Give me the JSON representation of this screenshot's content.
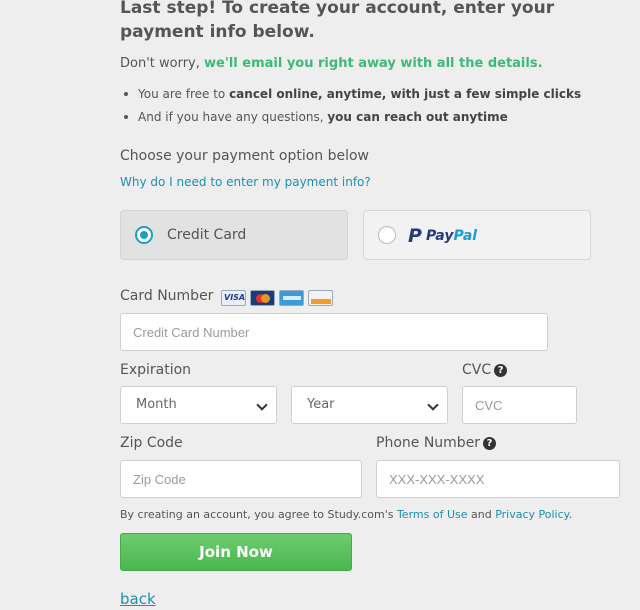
{
  "heading": "Last step! To create your account, enter your payment info below.",
  "reassure": {
    "prefix": "Don't worry, ",
    "highlight": "we'll email you right away with all the details."
  },
  "bullets": [
    {
      "prefix": "You are free to ",
      "bold": "cancel online, anytime, with just a few simple clicks"
    },
    {
      "prefix": "And if you have any questions, ",
      "bold": "you can reach out anytime"
    }
  ],
  "choose_label": "Choose your payment option below",
  "why_link": "Why do I need to enter my payment info?",
  "payment_options": {
    "credit_card": {
      "label": "Credit Card",
      "selected": true
    },
    "paypal": {
      "label_a": "Pay",
      "label_b": "Pal",
      "selected": false
    }
  },
  "card_number": {
    "label": "Card Number",
    "placeholder": "Credit Card Number",
    "card_icons": [
      "visa-icon",
      "mastercard-icon",
      "amex-icon",
      "discover-icon"
    ]
  },
  "expiration": {
    "label": "Expiration",
    "month_value": "Month",
    "year_value": "Year"
  },
  "cvc": {
    "label": "CVC",
    "placeholder": "CVC",
    "help_glyph": "?"
  },
  "zip": {
    "label": "Zip Code",
    "placeholder": "Zip Code"
  },
  "phone": {
    "label": "Phone Number",
    "placeholder": "XXX-XXX-XXXX",
    "help_glyph": "?"
  },
  "terms": {
    "prefix": "By creating an account, you agree to Study.com's ",
    "terms_link": "Terms of Use",
    "middle": " and ",
    "privacy_link": "Privacy Policy",
    "suffix": "."
  },
  "join_button": "Join Now",
  "back_link": "back",
  "colors": {
    "accent_green": "#4cb650",
    "link_blue": "#1d8fb0",
    "highlight_green": "#3fb87c",
    "radio_blue": "#1aa0c8"
  }
}
